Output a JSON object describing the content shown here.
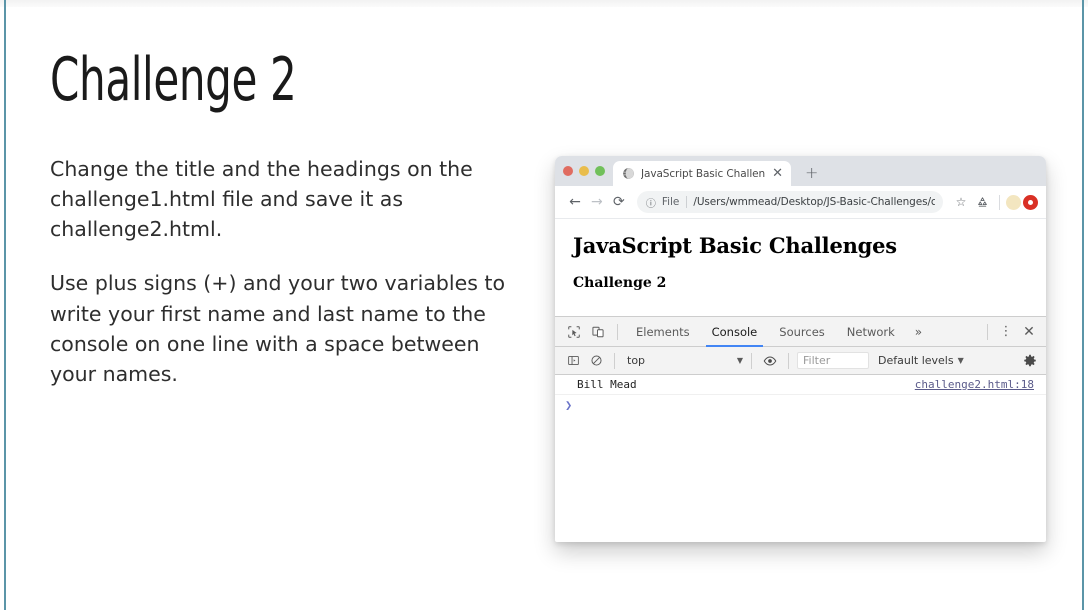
{
  "slide": {
    "title": "Challenge 2",
    "paragraphs": [
      "Change the title and the headings on the challenge1.html file and save it as challenge2.html.",
      "Use plus signs (+) and your two variables to write your first name and last name to the console on one line with a space between your names."
    ],
    "accent_color": "#5b95a8"
  },
  "browser": {
    "window_controls": {
      "close_color": "#e06c60",
      "minimize_color": "#e9bd4c",
      "zoom_color": "#71c05a"
    },
    "tab": {
      "title": "JavaScript Basic Challenges: Ch",
      "favicon": "globe-icon",
      "close_label": "✕"
    },
    "new_tab_label": "+",
    "toolbar": {
      "back_label": "←",
      "forward_label": "→",
      "reload_label": "⟳",
      "info_label": "ⓘ",
      "scheme_label": "File",
      "url": "/Users/wmmead/Desktop/JS-Basic-Challenges/chall...",
      "bookmark_label": "☆",
      "extension_icon": "recycle-icon",
      "profile_icon": "avatar-circle",
      "notification_icon": "red-circle-icon"
    },
    "page": {
      "h1": "JavaScript Basic Challenges",
      "h3": "Challenge 2"
    }
  },
  "devtools": {
    "inspect_icon": "inspect-cursor-icon",
    "device_icon": "device-toolbar-icon",
    "tabs": [
      {
        "label": "Elements",
        "active": false
      },
      {
        "label": "Console",
        "active": true
      },
      {
        "label": "Sources",
        "active": false
      },
      {
        "label": "Network",
        "active": false
      }
    ],
    "overflow_label": "»",
    "kebab_label": "⋮",
    "close_label": "✕",
    "active_tab_underline": "#4285f4",
    "console_toolbar": {
      "sidebar_icon": "console-sidebar-icon",
      "clear_icon": "clear-console-icon",
      "context": "top",
      "context_arrow": "▼",
      "eye_icon": "live-expression-icon",
      "filter_placeholder": "Filter",
      "levels_label": "Default levels",
      "levels_arrow": "▼",
      "settings_icon": "gear-icon"
    },
    "console": {
      "messages": [
        {
          "text": "Bill Mead",
          "source": "challenge2.html:18"
        }
      ],
      "prompt_caret": "❯"
    }
  }
}
